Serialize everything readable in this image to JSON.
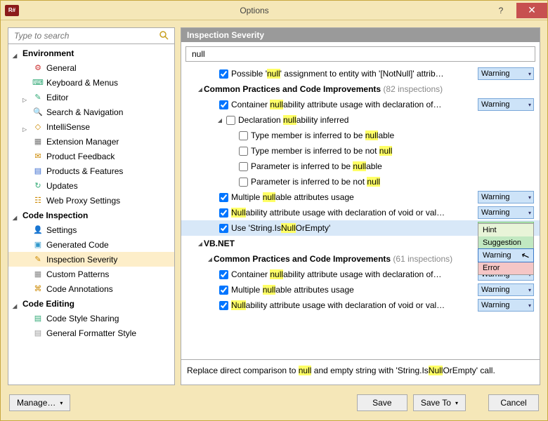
{
  "window": {
    "title": "Options",
    "appicon_label": "R#"
  },
  "sidebar": {
    "search_placeholder": "Type to search",
    "groups": [
      {
        "label": "Environment",
        "expanded": true,
        "items": [
          {
            "label": "General",
            "icon": "⚙",
            "color": "#c33"
          },
          {
            "label": "Keyboard & Menus",
            "icon": "⌨",
            "color": "#3a7"
          },
          {
            "label": "Editor",
            "icon": "✎",
            "color": "#3a7",
            "expandable": true
          },
          {
            "label": "Search & Navigation",
            "icon": "🔍",
            "color": "#c80"
          },
          {
            "label": "IntelliSense",
            "icon": "◇",
            "color": "#c80",
            "expandable": true
          },
          {
            "label": "Extension Manager",
            "icon": "▦",
            "color": "#777"
          },
          {
            "label": "Product Feedback",
            "icon": "✉",
            "color": "#c80"
          },
          {
            "label": "Products & Features",
            "icon": "▤",
            "color": "#36c"
          },
          {
            "label": "Updates",
            "icon": "↻",
            "color": "#3a7"
          },
          {
            "label": "Web Proxy Settings",
            "icon": "☷",
            "color": "#c80"
          }
        ]
      },
      {
        "label": "Code Inspection",
        "expanded": true,
        "items": [
          {
            "label": "Settings",
            "icon": "👤",
            "color": "#c80"
          },
          {
            "label": "Generated Code",
            "icon": "▣",
            "color": "#39c"
          },
          {
            "label": "Inspection Severity",
            "icon": "✎",
            "color": "#c80",
            "selected": true
          },
          {
            "label": "Custom Patterns",
            "icon": "▦",
            "color": "#888"
          },
          {
            "label": "Code Annotations",
            "icon": "⌘",
            "color": "#c80"
          }
        ]
      },
      {
        "label": "Code Editing",
        "expanded": true,
        "items": [
          {
            "label": "Code Style Sharing",
            "icon": "▤",
            "color": "#3a7"
          },
          {
            "label": "General Formatter Style",
            "icon": "▤",
            "color": "#999"
          }
        ]
      }
    ]
  },
  "main": {
    "header": "Inspection Severity",
    "filter": "null",
    "rows": [
      {
        "ind": 3,
        "cb": true,
        "chk": true,
        "text": "Possible '<hl>null</hl>' assignment to entity with '[NotNull]' attrib…",
        "sev": "Warning"
      },
      {
        "ind": 1,
        "exp": "open",
        "bold": "Common Practices and Code Improvements",
        "gray": "(82 inspections)"
      },
      {
        "ind": 3,
        "cb": true,
        "chk": true,
        "text": "Container <hl>null</hl>ability attribute usage with declaration of…",
        "sev": "Warning"
      },
      {
        "ind": 3,
        "exp": "open",
        "cb": true,
        "chk": false,
        "text": "Declaration <hl>null</hl>ability inferred"
      },
      {
        "ind": 5,
        "cb": true,
        "chk": false,
        "text": "Type member is inferred to be <hl>null</hl>able"
      },
      {
        "ind": 5,
        "cb": true,
        "chk": false,
        "text": "Type member is inferred to be not <hl>null</hl>"
      },
      {
        "ind": 5,
        "cb": true,
        "chk": false,
        "text": "Parameter is inferred to be <hl>null</hl>able"
      },
      {
        "ind": 5,
        "cb": true,
        "chk": false,
        "text": "Parameter is inferred to be not <hl>null</hl>"
      },
      {
        "ind": 3,
        "cb": true,
        "chk": true,
        "text": "Multiple <hl>null</hl>able attributes usage",
        "sev": "Warning"
      },
      {
        "ind": 3,
        "cb": true,
        "chk": true,
        "text": "<hl>Null</hl>ability attribute usage with declaration of void or val…",
        "sev": "Warning"
      },
      {
        "ind": 3,
        "cb": true,
        "chk": true,
        "text": "Use 'String.Is<hl>Null</hl>OrEmpty'",
        "sev": "Suggestion",
        "sel": true
      },
      {
        "ind": 1,
        "exp": "open",
        "bold": "VB.NET"
      },
      {
        "ind": 2,
        "exp": "open",
        "bold": "Common Practices and Code Improvements",
        "gray": "(61 inspections)"
      },
      {
        "ind": 3,
        "cb": true,
        "chk": true,
        "text": "Container <hl>null</hl>ability attribute usage with declaration of…",
        "sev": "Warning"
      },
      {
        "ind": 3,
        "cb": true,
        "chk": true,
        "text": "Multiple <hl>null</hl>able attributes usage",
        "sev": "Warning"
      },
      {
        "ind": 3,
        "cb": true,
        "chk": true,
        "text": "<hl>Null</hl>ability attribute usage with declaration of void or val…",
        "sev": "Warning"
      }
    ],
    "dropdown": {
      "hint": "Hint",
      "suggestion": "Suggestion",
      "warning": "Warning",
      "error": "Error"
    },
    "description": "Replace direct comparison to <hl>null</hl> and empty string with 'String.Is<hl>Null</hl>OrEmpty' call."
  },
  "footer": {
    "manage": "Manage…",
    "save": "Save",
    "saveto": "Save To",
    "cancel": "Cancel"
  }
}
